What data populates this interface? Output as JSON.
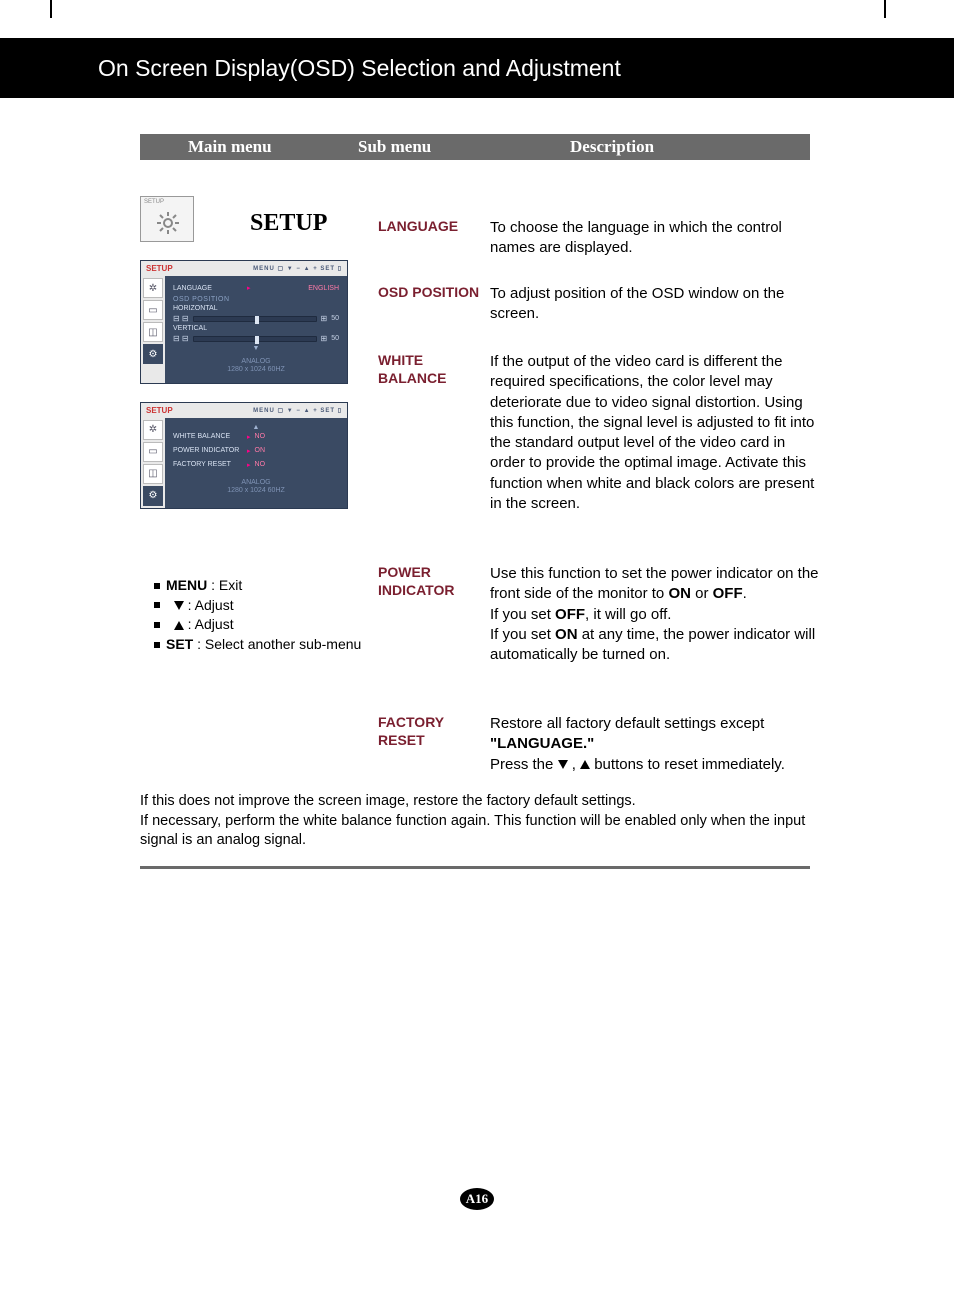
{
  "header": {
    "title": "On Screen Display(OSD) Selection and Adjustment"
  },
  "columns": {
    "c1": "Main menu",
    "c2": "Sub menu",
    "c3": "Description"
  },
  "setup": {
    "icon_label": "SETUP",
    "title": "SETUP"
  },
  "osd1": {
    "title": "SETUP",
    "btns": "MENU ▢  ▼ −  ▲ +  SET ▯",
    "rows": {
      "language_label": "LANGUAGE",
      "language_value": "ENGLISH",
      "osd_position": "OSD  POSITION",
      "horizontal": "HORIZONTAL",
      "horizontal_val": "50",
      "vertical": "VERTICAL",
      "vertical_val": "50"
    },
    "signal1": "ANALOG",
    "signal2": "1280 x 1024   60HZ"
  },
  "osd2": {
    "title": "SETUP",
    "btns": "MENU ▢  ▼ −  ▲ +  SET ▯",
    "rows": {
      "white_balance": "WHITE  BALANCE",
      "white_balance_val": "NO",
      "power_indicator": "POWER  INDICATOR",
      "power_indicator_val": "ON",
      "factory_reset": "FACTORY  RESET",
      "factory_reset_val": "NO"
    },
    "signal1": "ANALOG",
    "signal2": "1280 x 1024   60HZ"
  },
  "legend": {
    "menu_b": "MENU",
    "menu_t": " : Exit",
    "adj": " : Adjust",
    "set_b": "SET",
    "set_t": " : Select another sub-menu"
  },
  "sub": {
    "language": "LANGUAGE",
    "osd_position": "OSD POSITION",
    "white_balance": "WHITE BALANCE",
    "power_indicator": "POWER INDICATOR",
    "factory_reset": "FACTORY RESET"
  },
  "desc": {
    "language": "To choose the language in which the control names are displayed.",
    "osd_position": "To adjust position of the OSD window on the screen.",
    "white_balance": "If the output of the video card is different the required specifications, the color level may deteriorate due to video signal distortion. Using this function, the signal level is adjusted to fit into the standard output level of the video card in order to provide the optimal image. Activate this function when white and black colors are present in the screen.",
    "power_indicator_1": "Use this function to set the power indicator on the front side of the monitor to ",
    "on": "ON",
    "or": " or ",
    "off": "OFF",
    "dot": ".",
    "power_indicator_2a": "If you set ",
    "power_indicator_2b": ", it will go off.",
    "power_indicator_3a": "If you set ",
    "power_indicator_3b": " at any time, the power indicator will automatically be turned on.",
    "factory_reset_1": "Restore all factory default settings except ",
    "factory_reset_q": "\"LANGUAGE.\"",
    "factory_reset_2a": "Press the ",
    "factory_reset_2b": " ,  ",
    "factory_reset_2c": " buttons to reset immediately."
  },
  "foot": "If this does not improve the screen image, restore the factory default settings.\nIf necessary, perform the white balance function again. This function will be enabled only when the input signal is an analog signal.",
  "page": "A16"
}
